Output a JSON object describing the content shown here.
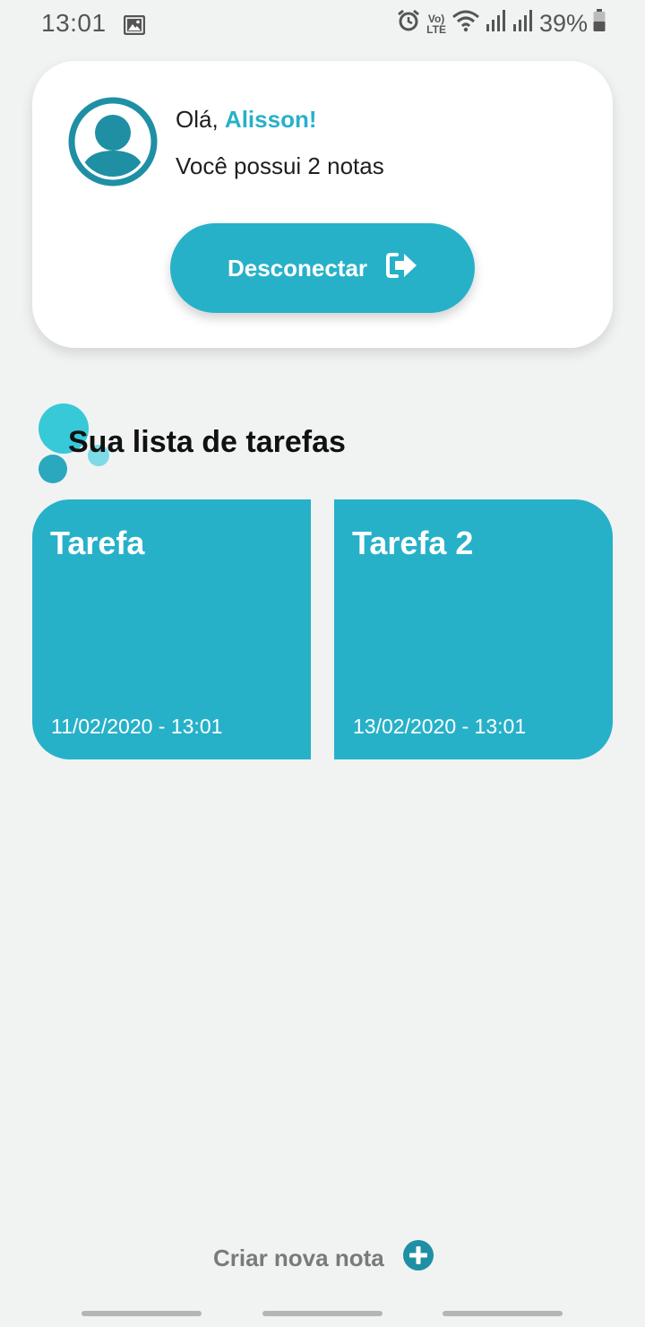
{
  "status_bar": {
    "time": "13:01",
    "network_label_top": "Vo)",
    "network_label_bottom": "LTE",
    "battery": "39%",
    "icons": [
      "image-icon",
      "alarm-icon",
      "volte-icon",
      "wifi-icon",
      "signal-icon",
      "signal-icon",
      "battery-icon"
    ]
  },
  "profile": {
    "greeting_prefix": "Olá, ",
    "user_name": "Alisson!",
    "notes_message": "Você possui 2 notas",
    "logout_label": "Desconectar",
    "logout_icon": "sign-out-icon"
  },
  "tasks_section": {
    "title": "Sua lista de tarefas",
    "tasks": [
      {
        "title": "Tarefa",
        "date": "11/02/2020 - 13:01"
      },
      {
        "title": "Tarefa 2",
        "date": "13/02/2020 - 13:01"
      }
    ]
  },
  "footer": {
    "create_note_label": "Criar nova nota",
    "create_note_icon": "plus-circle-icon"
  },
  "colors": {
    "accent": "#27b1c9",
    "avatar": "#1f8fa4",
    "background": "#f1f3f3",
    "deco_light": "#38c9d8",
    "deco_dark": "#2aa8bd"
  }
}
